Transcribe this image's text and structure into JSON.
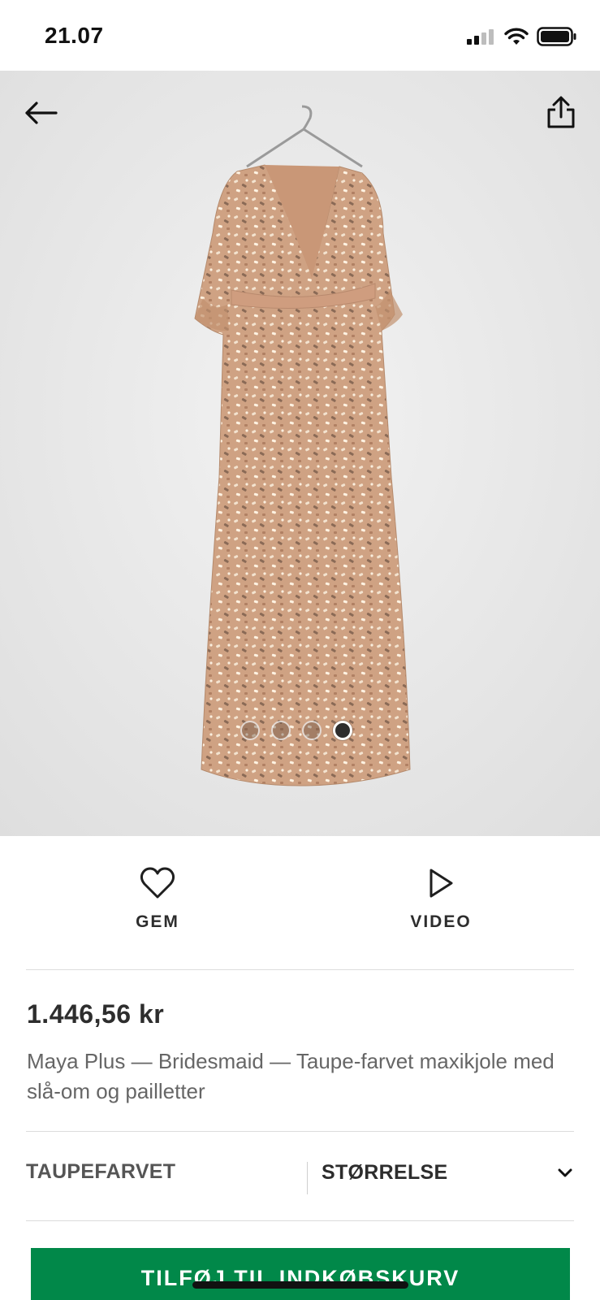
{
  "status_bar": {
    "time": "21.07"
  },
  "gallery": {
    "image_alt": "Maya Plus — Bridesmaid — Taupe-farvet maxikjole med slå-om og pailletter",
    "slides": 4,
    "active_slide": 4
  },
  "actions": {
    "save_label": "GEM",
    "video_label": "VIDEO"
  },
  "product": {
    "price": "1.446,56 kr",
    "name": "Maya Plus — Bridesmaid — Taupe-farvet maxikjole med slå-om og pailletter"
  },
  "selectors": {
    "colour": "TAUPEFARVET",
    "size_label": "STØRRELSE"
  },
  "cta": {
    "label": "TILFØJ TIL INDKØBSKURV"
  },
  "colors": {
    "cta_green": "#018849",
    "text_dark": "#2d2d2d",
    "dress_taupe": "#d4a98a"
  }
}
